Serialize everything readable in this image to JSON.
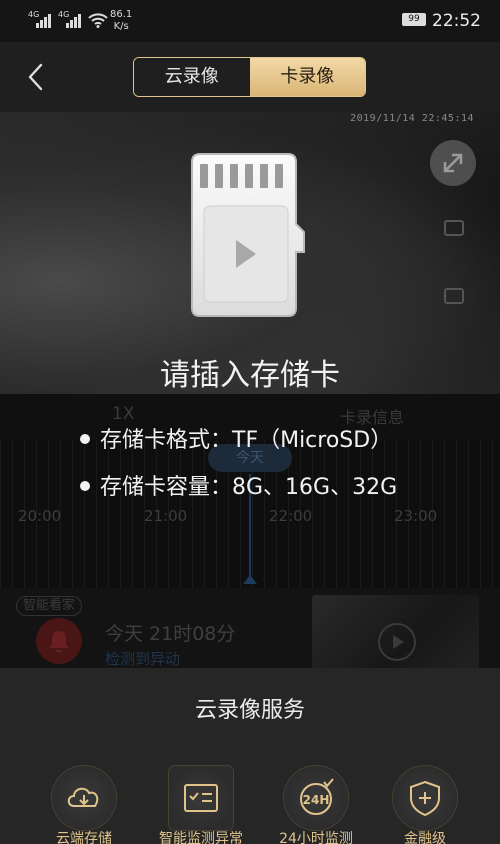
{
  "status_bar": {
    "signal1": "4G",
    "signal2": "4G",
    "net_speed_value": "86.1",
    "net_speed_unit": "K/s",
    "battery": "99",
    "time": "22:52"
  },
  "nav": {
    "tab_cloud": "云录像",
    "tab_card": "卡录像",
    "active_tab": "卡录像"
  },
  "video": {
    "timestamp": "2019/11/14  22:45:14"
  },
  "controls": {
    "speed": "1X",
    "card_info": "卡录信息"
  },
  "timeline": {
    "today": "今天",
    "ticks": [
      "20:00",
      "21:00",
      "22:00",
      "23:00"
    ]
  },
  "event": {
    "tag": "智能看家",
    "time": "今天  21时08分",
    "description": "检测到异动"
  },
  "overlay": {
    "title": "请插入存储卡",
    "line1": "存储卡格式：TF（MicroSD）",
    "line2": "存储卡容量：8G、16G、32G"
  },
  "sheet": {
    "title": "云录像服务",
    "services": [
      {
        "label": "云端存储",
        "icon": "cloud-download-icon"
      },
      {
        "label": "智能监测异常",
        "icon": "checklist-icon"
      },
      {
        "label": "24小时监测",
        "icon": "24h-icon"
      },
      {
        "label": "金融级",
        "icon": "shield-plus-icon"
      }
    ]
  },
  "colors": {
    "accent_gold": "#e3c68f",
    "background": "#1b1b1b",
    "overlay_text": "#f2f2f2"
  }
}
